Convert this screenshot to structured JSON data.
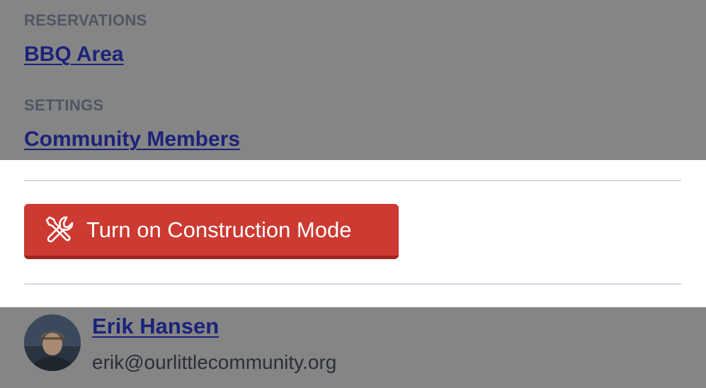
{
  "nav": {
    "sections": [
      {
        "label": "RESERVATIONS",
        "links": [
          "BBQ Area"
        ]
      },
      {
        "label": "SETTINGS",
        "links": [
          "Community Members"
        ]
      }
    ]
  },
  "construction": {
    "button_label": "Turn on Construction Mode",
    "icon": "tools-icon",
    "color": "#cc3a32"
  },
  "user": {
    "name": "Erik Hansen",
    "email": "erik@ourlittlecommunity.org"
  },
  "colors": {
    "overlay": "#858585",
    "link": "#1b237a",
    "accent_danger": "#cc3a32"
  }
}
